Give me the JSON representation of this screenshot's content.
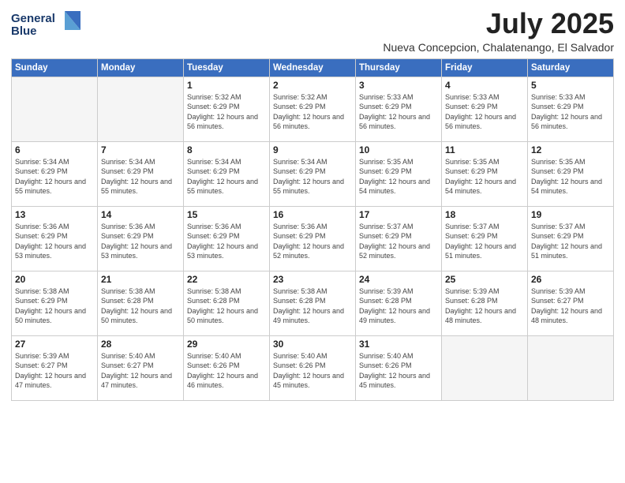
{
  "logo": {
    "line1": "General",
    "line2": "Blue"
  },
  "title": "July 2025",
  "location": "Nueva Concepcion, Chalatenango, El Salvador",
  "days_of_week": [
    "Sunday",
    "Monday",
    "Tuesday",
    "Wednesday",
    "Thursday",
    "Friday",
    "Saturday"
  ],
  "weeks": [
    [
      {
        "day": "",
        "info": ""
      },
      {
        "day": "",
        "info": ""
      },
      {
        "day": "1",
        "info": "Sunrise: 5:32 AM\nSunset: 6:29 PM\nDaylight: 12 hours and 56 minutes."
      },
      {
        "day": "2",
        "info": "Sunrise: 5:32 AM\nSunset: 6:29 PM\nDaylight: 12 hours and 56 minutes."
      },
      {
        "day": "3",
        "info": "Sunrise: 5:33 AM\nSunset: 6:29 PM\nDaylight: 12 hours and 56 minutes."
      },
      {
        "day": "4",
        "info": "Sunrise: 5:33 AM\nSunset: 6:29 PM\nDaylight: 12 hours and 56 minutes."
      },
      {
        "day": "5",
        "info": "Sunrise: 5:33 AM\nSunset: 6:29 PM\nDaylight: 12 hours and 56 minutes."
      }
    ],
    [
      {
        "day": "6",
        "info": "Sunrise: 5:34 AM\nSunset: 6:29 PM\nDaylight: 12 hours and 55 minutes."
      },
      {
        "day": "7",
        "info": "Sunrise: 5:34 AM\nSunset: 6:29 PM\nDaylight: 12 hours and 55 minutes."
      },
      {
        "day": "8",
        "info": "Sunrise: 5:34 AM\nSunset: 6:29 PM\nDaylight: 12 hours and 55 minutes."
      },
      {
        "day": "9",
        "info": "Sunrise: 5:34 AM\nSunset: 6:29 PM\nDaylight: 12 hours and 55 minutes."
      },
      {
        "day": "10",
        "info": "Sunrise: 5:35 AM\nSunset: 6:29 PM\nDaylight: 12 hours and 54 minutes."
      },
      {
        "day": "11",
        "info": "Sunrise: 5:35 AM\nSunset: 6:29 PM\nDaylight: 12 hours and 54 minutes."
      },
      {
        "day": "12",
        "info": "Sunrise: 5:35 AM\nSunset: 6:29 PM\nDaylight: 12 hours and 54 minutes."
      }
    ],
    [
      {
        "day": "13",
        "info": "Sunrise: 5:36 AM\nSunset: 6:29 PM\nDaylight: 12 hours and 53 minutes."
      },
      {
        "day": "14",
        "info": "Sunrise: 5:36 AM\nSunset: 6:29 PM\nDaylight: 12 hours and 53 minutes."
      },
      {
        "day": "15",
        "info": "Sunrise: 5:36 AM\nSunset: 6:29 PM\nDaylight: 12 hours and 53 minutes."
      },
      {
        "day": "16",
        "info": "Sunrise: 5:36 AM\nSunset: 6:29 PM\nDaylight: 12 hours and 52 minutes."
      },
      {
        "day": "17",
        "info": "Sunrise: 5:37 AM\nSunset: 6:29 PM\nDaylight: 12 hours and 52 minutes."
      },
      {
        "day": "18",
        "info": "Sunrise: 5:37 AM\nSunset: 6:29 PM\nDaylight: 12 hours and 51 minutes."
      },
      {
        "day": "19",
        "info": "Sunrise: 5:37 AM\nSunset: 6:29 PM\nDaylight: 12 hours and 51 minutes."
      }
    ],
    [
      {
        "day": "20",
        "info": "Sunrise: 5:38 AM\nSunset: 6:29 PM\nDaylight: 12 hours and 50 minutes."
      },
      {
        "day": "21",
        "info": "Sunrise: 5:38 AM\nSunset: 6:28 PM\nDaylight: 12 hours and 50 minutes."
      },
      {
        "day": "22",
        "info": "Sunrise: 5:38 AM\nSunset: 6:28 PM\nDaylight: 12 hours and 50 minutes."
      },
      {
        "day": "23",
        "info": "Sunrise: 5:38 AM\nSunset: 6:28 PM\nDaylight: 12 hours and 49 minutes."
      },
      {
        "day": "24",
        "info": "Sunrise: 5:39 AM\nSunset: 6:28 PM\nDaylight: 12 hours and 49 minutes."
      },
      {
        "day": "25",
        "info": "Sunrise: 5:39 AM\nSunset: 6:28 PM\nDaylight: 12 hours and 48 minutes."
      },
      {
        "day": "26",
        "info": "Sunrise: 5:39 AM\nSunset: 6:27 PM\nDaylight: 12 hours and 48 minutes."
      }
    ],
    [
      {
        "day": "27",
        "info": "Sunrise: 5:39 AM\nSunset: 6:27 PM\nDaylight: 12 hours and 47 minutes."
      },
      {
        "day": "28",
        "info": "Sunrise: 5:40 AM\nSunset: 6:27 PM\nDaylight: 12 hours and 47 minutes."
      },
      {
        "day": "29",
        "info": "Sunrise: 5:40 AM\nSunset: 6:26 PM\nDaylight: 12 hours and 46 minutes."
      },
      {
        "day": "30",
        "info": "Sunrise: 5:40 AM\nSunset: 6:26 PM\nDaylight: 12 hours and 45 minutes."
      },
      {
        "day": "31",
        "info": "Sunrise: 5:40 AM\nSunset: 6:26 PM\nDaylight: 12 hours and 45 minutes."
      },
      {
        "day": "",
        "info": ""
      },
      {
        "day": "",
        "info": ""
      }
    ]
  ]
}
